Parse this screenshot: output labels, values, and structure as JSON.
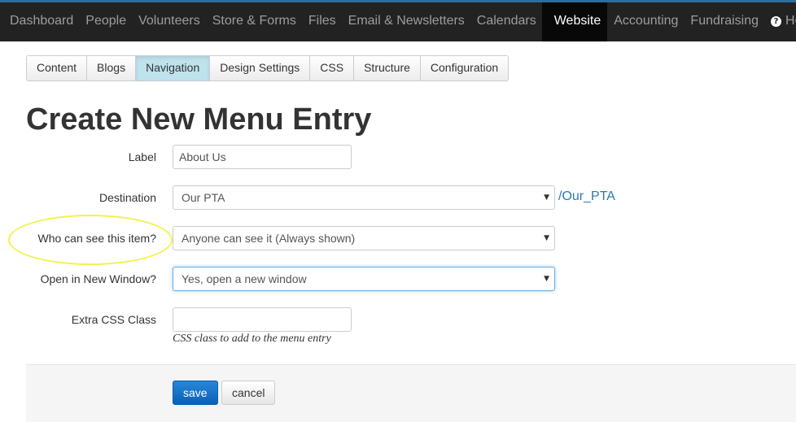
{
  "nav": {
    "items": [
      {
        "label": "Dashboard"
      },
      {
        "label": "People"
      },
      {
        "label": "Volunteers"
      },
      {
        "label": "Store & Forms"
      },
      {
        "label": "Files"
      },
      {
        "label": "Email & Newsletters"
      },
      {
        "label": "Calendars"
      },
      {
        "label": "Website",
        "active": true
      },
      {
        "label": "Accounting"
      },
      {
        "label": "Fundraising"
      }
    ],
    "help_label": "Help"
  },
  "tabs": {
    "items": [
      {
        "label": "Content"
      },
      {
        "label": "Blogs"
      },
      {
        "label": "Navigation",
        "active": true
      },
      {
        "label": "Design Settings"
      },
      {
        "label": "CSS"
      },
      {
        "label": "Structure"
      },
      {
        "label": "Configuration"
      }
    ]
  },
  "page": {
    "title": "Create New Menu Entry"
  },
  "form": {
    "label": {
      "label": "Label",
      "value": "About Us"
    },
    "destination": {
      "label": "Destination",
      "value": "Our PTA",
      "link": "/Our_PTA"
    },
    "visibility": {
      "label": "Who can see this item?",
      "value": "Anyone can see it (Always shown)"
    },
    "new_window": {
      "label": "Open in New Window?",
      "value": "Yes, open a new window"
    },
    "css_class": {
      "label": "Extra CSS Class",
      "value": "",
      "help": "CSS class to add to the menu entry"
    }
  },
  "actions": {
    "save_label": "save",
    "cancel_label": "cancel"
  },
  "colors": {
    "navbar": "#222222",
    "active_tab": "#bfe3ec",
    "primary_button": "#0a60b8",
    "link": "#2a7ab0",
    "highlight": "#f2f24a"
  }
}
